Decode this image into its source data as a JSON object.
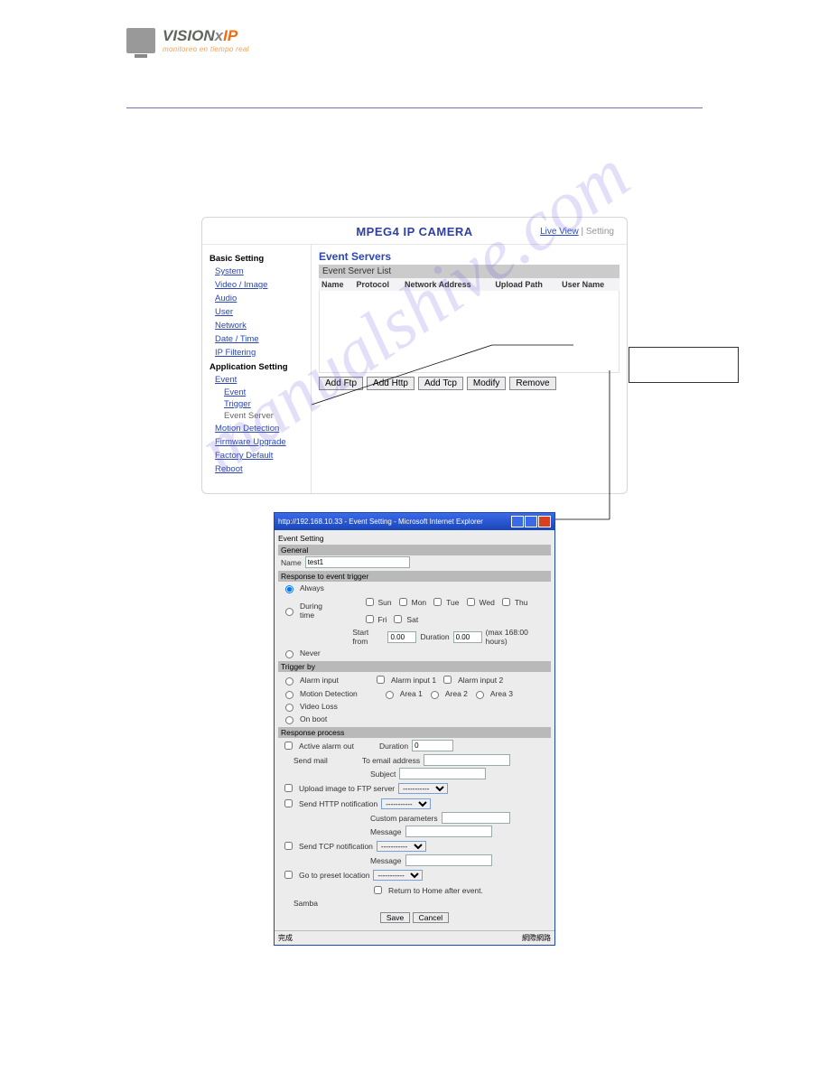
{
  "logo": {
    "brand_1": "VISION",
    "brand_2": "x",
    "brand_3": "IP",
    "tagline": "monitoreo en tiempo real"
  },
  "watermark": "manualshive.com",
  "panel": {
    "title": "MPEG4 IP CAMERA",
    "links": {
      "live": "Live View",
      "sep": "|",
      "setting": "Setting"
    }
  },
  "sidebar": {
    "sections": [
      {
        "heading": "Basic Setting",
        "items": [
          "System",
          "Video / Image",
          "Audio",
          "User",
          "Network",
          "Date / Time",
          "IP Filtering"
        ]
      },
      {
        "heading": "Application Setting",
        "items": [
          "Event"
        ],
        "sub": [
          "Event",
          "Trigger",
          "Event Server"
        ],
        "after": [
          "Motion Detection",
          "Firmware Upgrade",
          "Factory Default",
          "Reboot"
        ]
      }
    ]
  },
  "content": {
    "title": "Event Servers",
    "subtitle": "Event Server List",
    "columns": [
      "Name",
      "Protocol",
      "Network Address",
      "Upload Path",
      "User Name"
    ],
    "buttons": [
      "Add Ftp",
      "Add Http",
      "Add Tcp",
      "Modify",
      "Remove"
    ]
  },
  "dialog": {
    "titlebar": "http://192.168.10.33 - Event Setting - Microsoft Internet Explorer",
    "heading": "Event Setting",
    "sec_general": "General",
    "name_label": "Name",
    "name_value": "test1",
    "resp_label": "Response to event trigger",
    "always": "Always",
    "during": "During time",
    "days": [
      "Sun",
      "Mon",
      "Tue",
      "Wed",
      "Thu",
      "Fri",
      "Sat"
    ],
    "start_from": "Start from",
    "start_val": "0.00",
    "duration": "Duration",
    "duration_val": "0.00",
    "duration_note": "(max 168:00 hours)",
    "never": "Never",
    "sec_trigger": "Trigger by",
    "alarm_input": "Alarm input",
    "alarm1": "Alarm input 1",
    "alarm2": "Alarm input 2",
    "motion": "Motion Detection",
    "area1": "Area 1",
    "area2": "Area 2",
    "area3": "Area 3",
    "video_loss": "Video Loss",
    "on_boot": "On boot",
    "sec_response": "Response process",
    "active_out": "Active alarm out",
    "dur2": "Duration",
    "dur2_val": "0",
    "send_mail": "Send mail",
    "to_email": "To email address",
    "subject": "Subject",
    "upload_ftp": "Upload image to FTP server",
    "send_http": "Send HTTP notification",
    "custom_params": "Custom parameters",
    "message": "Message",
    "send_tcp": "Send TCP notification",
    "message2": "Message",
    "go_preset": "Go to preset location",
    "return_home": "Return to Home after event.",
    "samba": "Samba",
    "save": "Save",
    "cancel": "Cancel",
    "status_left": "完成",
    "status_right": "網際網路"
  }
}
